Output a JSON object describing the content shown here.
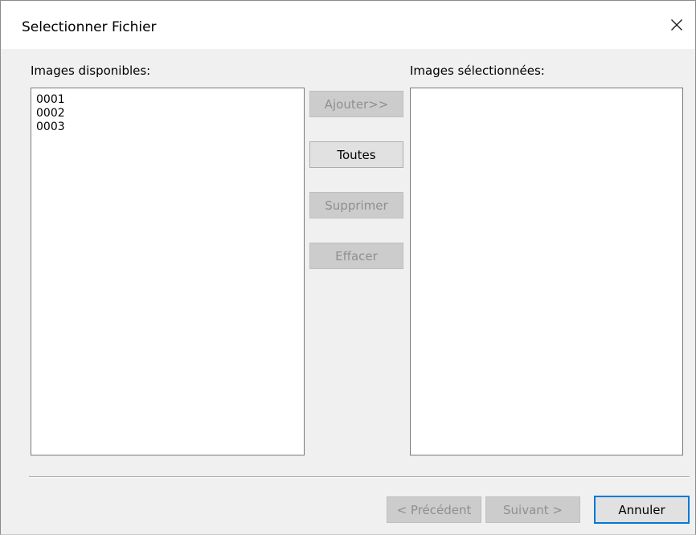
{
  "window": {
    "title": "Selectionner Fichier"
  },
  "available": {
    "label": "Images disponibles:",
    "items": [
      "0001",
      "0002",
      "0003"
    ]
  },
  "selected": {
    "label": "Images sélectionnées:",
    "items": []
  },
  "actions": {
    "add": "Ajouter>>",
    "all": "Toutes",
    "remove": "Supprimer",
    "clear": "Effacer"
  },
  "footer": {
    "previous": "< Précédent",
    "next": "Suivant >",
    "cancel": "Annuler"
  },
  "icons": {
    "close": "close-icon"
  }
}
